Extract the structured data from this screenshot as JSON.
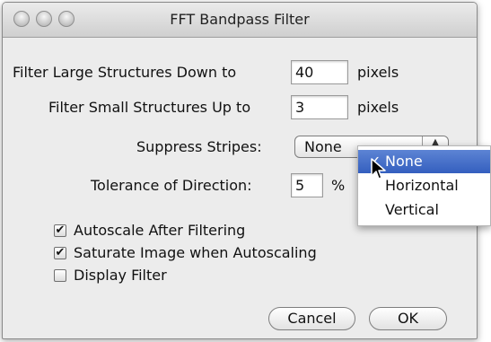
{
  "window": {
    "title": "FFT Bandpass Filter"
  },
  "form": {
    "large_label": "Filter Large Structures Down to",
    "large_value": "40",
    "large_unit": "pixels",
    "small_label": "Filter Small Structures Up to",
    "small_value": "3",
    "small_unit": "pixels",
    "stripes_label": "Suppress Stripes:",
    "stripes_value": "None",
    "tolerance_label": "Tolerance of Direction:",
    "tolerance_value": "5",
    "tolerance_unit": "%"
  },
  "options": {
    "autoscale_label": "Autoscale After Filtering",
    "autoscale_checked": true,
    "saturate_label": "Saturate Image when Autoscaling",
    "saturate_checked": true,
    "display_filter_label": "Display Filter",
    "display_filter_checked": false
  },
  "buttons": {
    "cancel": "Cancel",
    "ok": "OK"
  },
  "dropdown": {
    "options": [
      "None",
      "Horizontal",
      "Vertical"
    ],
    "selected": "None"
  },
  "colors": {
    "selection": "#3b66c4",
    "window_bg": "#ececec"
  },
  "icons": {
    "checkmark": "✓",
    "checkbox_mark": "✔",
    "popup_arrow": "▲"
  }
}
